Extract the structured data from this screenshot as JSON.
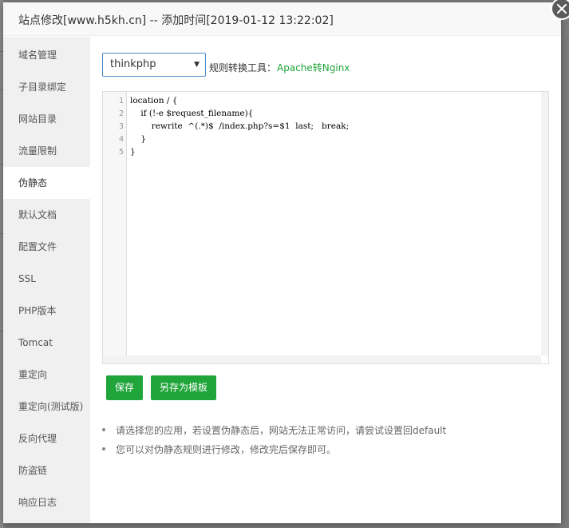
{
  "dialog": {
    "title": "站点修改[www.h5kh.cn] -- 添加时间[2019-01-12 13:22:02]",
    "close_icon": "close-icon"
  },
  "sidebar": {
    "items": [
      {
        "label": "域名管理"
      },
      {
        "label": "子目录绑定"
      },
      {
        "label": "网站目录"
      },
      {
        "label": "流量限制"
      },
      {
        "label": "伪静态",
        "active": true
      },
      {
        "label": "默认文档"
      },
      {
        "label": "配置文件"
      },
      {
        "label": "SSL"
      },
      {
        "label": "PHP版本"
      },
      {
        "label": "Tomcat"
      },
      {
        "label": "重定向"
      },
      {
        "label": "重定向(测试版)"
      },
      {
        "label": "反向代理"
      },
      {
        "label": "防盗链"
      },
      {
        "label": "响应日志"
      }
    ]
  },
  "rewrite": {
    "selected_template": "thinkphp",
    "tool_label": "规则转换工具：",
    "tool_link": "Apache转Nginx",
    "line_numbers": [
      "1",
      "2",
      "3",
      "4",
      "5"
    ],
    "code_lines": [
      "location / {",
      "    if (!-e $request_filename){",
      "        rewrite  ^(.*)$  /index.php?s=$1  last;   break;",
      "    }",
      "}"
    ],
    "save_label": "保存",
    "save_as_template_label": "另存为模板",
    "tips": [
      "请选择您的应用，若设置伪静态后，网站无法正常访问，请尝试设置回default",
      "您可以对伪静态规则进行修改，修改完后保存即可。"
    ]
  },
  "colors": {
    "accent": "#20a53a",
    "select_border": "#4a8bc9",
    "sidebar_bg": "#f0f0f0"
  }
}
